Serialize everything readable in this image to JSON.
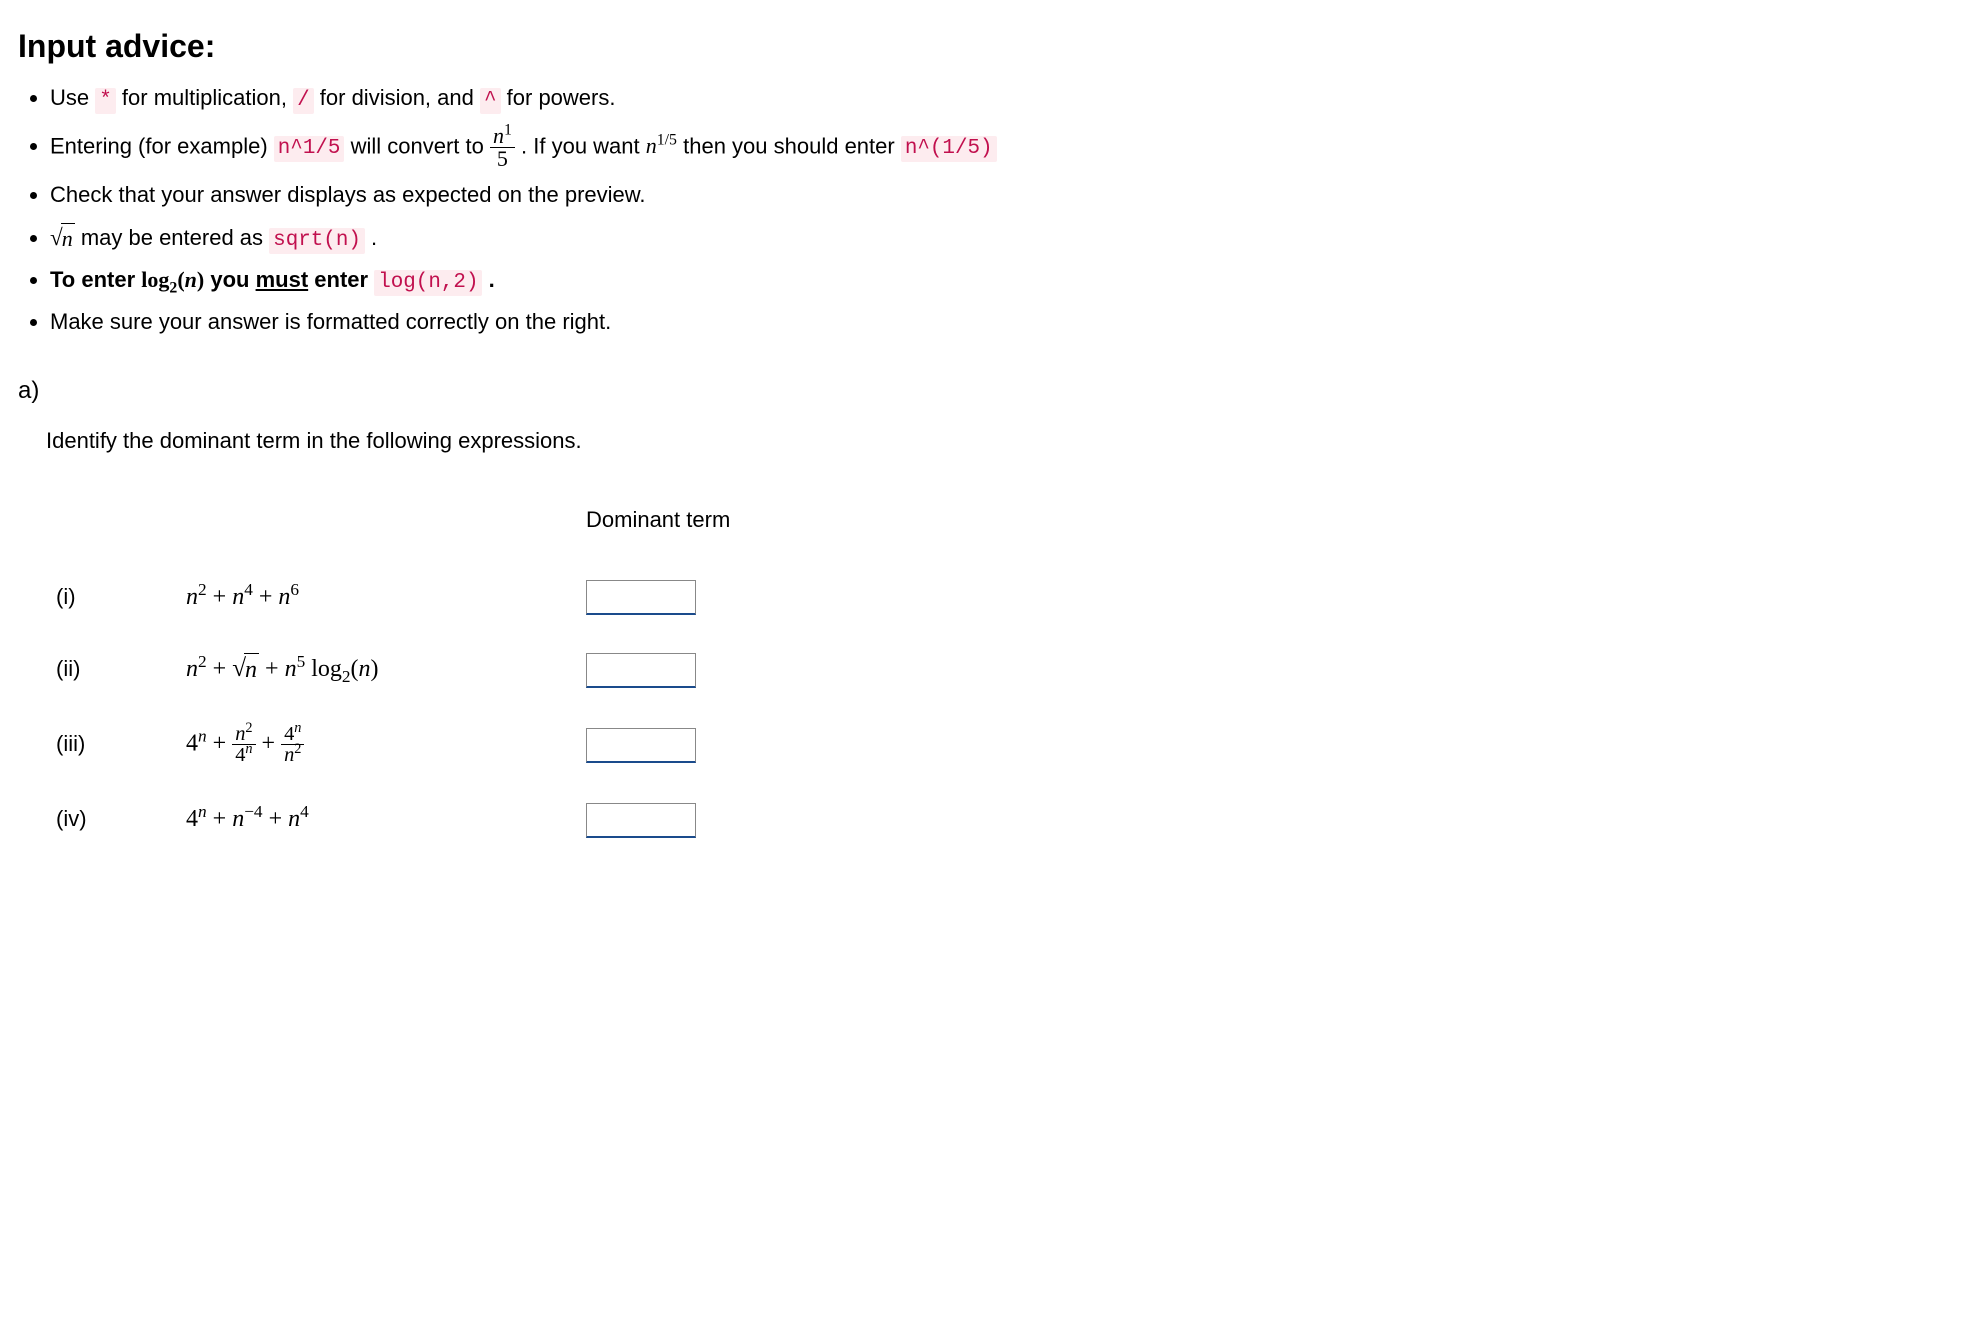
{
  "advice": {
    "heading": "Input advice:",
    "b1_a": "Use ",
    "b1_code1": "*",
    "b1_b": " for multiplication, ",
    "b1_code2": "/",
    "b1_c": " for division, and ",
    "b1_code3": "^",
    "b1_d": " for powers.",
    "b2_a": "Entering (for example) ",
    "b2_code1": "n^1/5",
    "b2_b": " will convert to ",
    "b2_c": ". If you want ",
    "b2_d": " then you should enter ",
    "b2_code2": "n^(1/5)",
    "b3": "Check that your answer displays as expected on the preview.",
    "b4_a": " may be entered as ",
    "b4_code": "sqrt(n)",
    "b4_dot": ".",
    "b5_a": "To enter ",
    "b5_b": " you ",
    "b5_must": "must",
    "b5_c": " enter ",
    "b5_code": "log(n,2)",
    "b5_dot": ".",
    "b6": "Make sure your answer is formatted correctly on the right."
  },
  "partA": {
    "label": "a)",
    "prompt": "Identify the dominant term in the following expressions.",
    "col_header": "Dominant term",
    "rows": [
      {
        "roman": "(i)",
        "value": ""
      },
      {
        "roman": "(ii)",
        "value": ""
      },
      {
        "roman": "(iii)",
        "value": ""
      },
      {
        "roman": "(iv)",
        "value": ""
      }
    ]
  }
}
